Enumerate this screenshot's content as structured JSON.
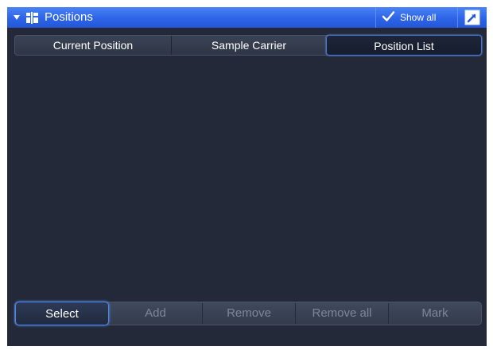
{
  "panel": {
    "title": "Positions",
    "show_all_label": "Show all",
    "icons": {
      "collapse": "collapse-arrow-icon",
      "panel": "positions-icon",
      "check": "check-icon",
      "undock": "undock-icon"
    }
  },
  "tabs": [
    {
      "label": "Current Position",
      "selected": false
    },
    {
      "label": "Sample Carrier",
      "selected": false
    },
    {
      "label": "Position List",
      "selected": true
    }
  ],
  "list": {
    "items": []
  },
  "toolbar": {
    "buttons": [
      {
        "label": "Select",
        "enabled": true,
        "selected": true
      },
      {
        "label": "Add",
        "enabled": false,
        "selected": false
      },
      {
        "label": "Remove",
        "enabled": false,
        "selected": false
      },
      {
        "label": "Remove all",
        "enabled": false,
        "selected": false
      },
      {
        "label": "Mark",
        "enabled": false,
        "selected": false
      }
    ]
  },
  "colors": {
    "title_bar": "#2d63e6",
    "panel_background": "#232938",
    "active_outline": "#4e86f0",
    "disabled_text": "#7e879a"
  }
}
